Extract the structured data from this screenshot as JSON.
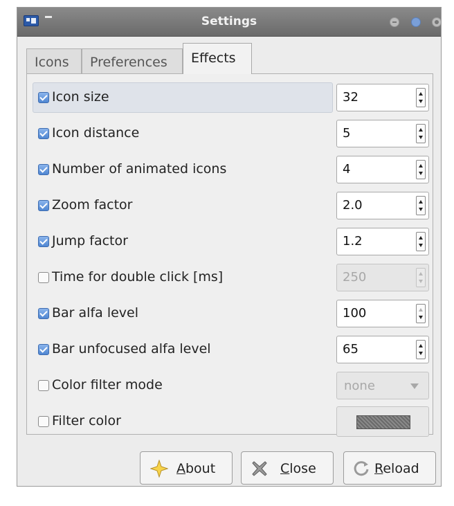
{
  "window": {
    "title": "Settings"
  },
  "tabs": [
    {
      "label": "Icons",
      "active": false
    },
    {
      "label": "Preferences",
      "active": false
    },
    {
      "label": "Effects",
      "active": true
    }
  ],
  "settings": [
    {
      "label": "Icon size",
      "checked": true,
      "control": "spin",
      "value": "32",
      "enabled": true
    },
    {
      "label": "Icon distance",
      "checked": true,
      "control": "spin",
      "value": "5",
      "enabled": true
    },
    {
      "label": "Number of animated icons",
      "checked": true,
      "control": "spin",
      "value": "4",
      "enabled": true
    },
    {
      "label": "Zoom factor",
      "checked": true,
      "control": "spin",
      "value": "2.0",
      "enabled": true
    },
    {
      "label": "Jump factor",
      "checked": true,
      "control": "spin",
      "value": "1.2",
      "enabled": true
    },
    {
      "label": "Time for double click [ms]",
      "checked": false,
      "control": "spin",
      "value": "250",
      "enabled": false
    },
    {
      "label": "Bar alfa level",
      "checked": true,
      "control": "spin",
      "value": "100",
      "enabled": true
    },
    {
      "label": "Bar unfocused alfa level",
      "checked": true,
      "control": "spin",
      "value": "65",
      "enabled": true
    },
    {
      "label": "Color filter mode",
      "checked": false,
      "control": "combo",
      "value": "none",
      "enabled": false
    },
    {
      "label": "Filter color",
      "checked": false,
      "control": "color",
      "value": "#777777",
      "enabled": false
    }
  ],
  "buttons": {
    "about": {
      "mnemonic": "A",
      "rest": "bout",
      "icon": "star-icon"
    },
    "close": {
      "mnemonic": "C",
      "rest": "lose",
      "icon": "close-x-icon"
    },
    "reload": {
      "mnemonic": "R",
      "rest": "eload",
      "icon": "reload-icon"
    }
  },
  "colors": {
    "titlebar": "#7a7a7a",
    "check_accent": "#4f86d2",
    "background": "#ececec"
  }
}
